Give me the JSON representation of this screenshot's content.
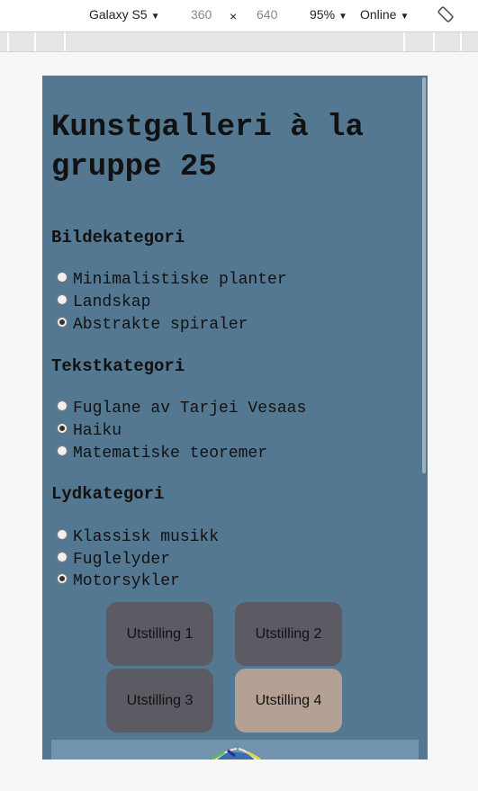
{
  "devtools": {
    "device": "Galaxy S5",
    "width": "360",
    "times": "×",
    "height": "640",
    "zoom": "95%",
    "network": "Online",
    "caret": "▼",
    "rotate_icon": "rotate-icon"
  },
  "page": {
    "title": "Kunstgalleri à la gruppe 25",
    "background": "#557892",
    "image_group": {
      "heading": "Bildekategori",
      "options": [
        {
          "label": "Minimalistiske planter",
          "checked": false
        },
        {
          "label": "Landskap",
          "checked": false
        },
        {
          "label": "Abstrakte spiraler",
          "checked": true
        }
      ]
    },
    "text_group": {
      "heading": "Tekstkategori",
      "options": [
        {
          "label": "Fuglane av Tarjei Vesaas",
          "checked": false
        },
        {
          "label": "Haiku",
          "checked": true
        },
        {
          "label": "Matematiske teoremer",
          "checked": false
        }
      ]
    },
    "sound_group": {
      "heading": "Lydkategori",
      "options": [
        {
          "label": "Klassisk musikk",
          "checked": false
        },
        {
          "label": "Fuglelyder",
          "checked": false
        },
        {
          "label": "Motorsykler",
          "checked": true
        }
      ]
    },
    "exhibitions": [
      {
        "label": "Utstilling 1",
        "active": false
      },
      {
        "label": "Utstilling 2",
        "active": false
      },
      {
        "label": "Utstilling 3",
        "active": false
      },
      {
        "label": "Utstilling 4",
        "active": true
      }
    ],
    "colors": {
      "button": "#5c5b63",
      "button_active": "#b5a193",
      "frame": "#7293ad"
    }
  }
}
